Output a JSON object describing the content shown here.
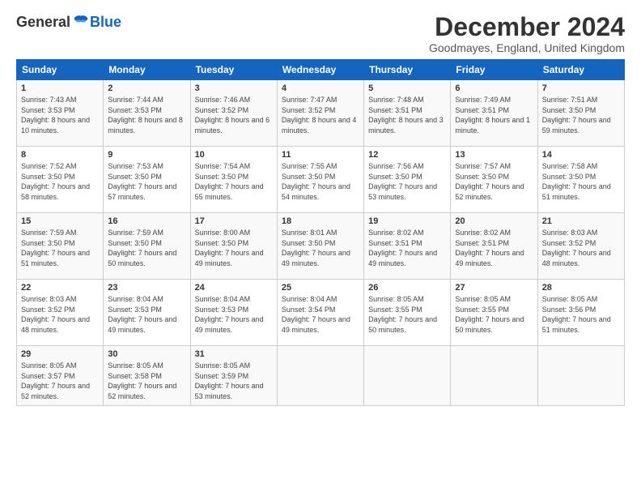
{
  "header": {
    "logo_general": "General",
    "logo_blue": "Blue",
    "title": "December 2024",
    "subtitle": "Goodmayes, England, United Kingdom"
  },
  "columns": [
    "Sunday",
    "Monday",
    "Tuesday",
    "Wednesday",
    "Thursday",
    "Friday",
    "Saturday"
  ],
  "weeks": [
    [
      {
        "day": "1",
        "sunrise": "7:43 AM",
        "sunset": "3:53 PM",
        "daylight": "8 hours and 10 minutes."
      },
      {
        "day": "2",
        "sunrise": "7:44 AM",
        "sunset": "3:53 PM",
        "daylight": "8 hours and 8 minutes."
      },
      {
        "day": "3",
        "sunrise": "7:46 AM",
        "sunset": "3:52 PM",
        "daylight": "8 hours and 6 minutes."
      },
      {
        "day": "4",
        "sunrise": "7:47 AM",
        "sunset": "3:52 PM",
        "daylight": "8 hours and 4 minutes."
      },
      {
        "day": "5",
        "sunrise": "7:48 AM",
        "sunset": "3:51 PM",
        "daylight": "8 hours and 3 minutes."
      },
      {
        "day": "6",
        "sunrise": "7:49 AM",
        "sunset": "3:51 PM",
        "daylight": "8 hours and 1 minute."
      },
      {
        "day": "7",
        "sunrise": "7:51 AM",
        "sunset": "3:50 PM",
        "daylight": "7 hours and 59 minutes."
      }
    ],
    [
      {
        "day": "8",
        "sunrise": "7:52 AM",
        "sunset": "3:50 PM",
        "daylight": "7 hours and 58 minutes."
      },
      {
        "day": "9",
        "sunrise": "7:53 AM",
        "sunset": "3:50 PM",
        "daylight": "7 hours and 57 minutes."
      },
      {
        "day": "10",
        "sunrise": "7:54 AM",
        "sunset": "3:50 PM",
        "daylight": "7 hours and 55 minutes."
      },
      {
        "day": "11",
        "sunrise": "7:55 AM",
        "sunset": "3:50 PM",
        "daylight": "7 hours and 54 minutes."
      },
      {
        "day": "12",
        "sunrise": "7:56 AM",
        "sunset": "3:50 PM",
        "daylight": "7 hours and 53 minutes."
      },
      {
        "day": "13",
        "sunrise": "7:57 AM",
        "sunset": "3:50 PM",
        "daylight": "7 hours and 52 minutes."
      },
      {
        "day": "14",
        "sunrise": "7:58 AM",
        "sunset": "3:50 PM",
        "daylight": "7 hours and 51 minutes."
      }
    ],
    [
      {
        "day": "15",
        "sunrise": "7:59 AM",
        "sunset": "3:50 PM",
        "daylight": "7 hours and 51 minutes."
      },
      {
        "day": "16",
        "sunrise": "7:59 AM",
        "sunset": "3:50 PM",
        "daylight": "7 hours and 50 minutes."
      },
      {
        "day": "17",
        "sunrise": "8:00 AM",
        "sunset": "3:50 PM",
        "daylight": "7 hours and 49 minutes."
      },
      {
        "day": "18",
        "sunrise": "8:01 AM",
        "sunset": "3:50 PM",
        "daylight": "7 hours and 49 minutes."
      },
      {
        "day": "19",
        "sunrise": "8:02 AM",
        "sunset": "3:51 PM",
        "daylight": "7 hours and 49 minutes."
      },
      {
        "day": "20",
        "sunrise": "8:02 AM",
        "sunset": "3:51 PM",
        "daylight": "7 hours and 49 minutes."
      },
      {
        "day": "21",
        "sunrise": "8:03 AM",
        "sunset": "3:52 PM",
        "daylight": "7 hours and 48 minutes."
      }
    ],
    [
      {
        "day": "22",
        "sunrise": "8:03 AM",
        "sunset": "3:52 PM",
        "daylight": "7 hours and 48 minutes."
      },
      {
        "day": "23",
        "sunrise": "8:04 AM",
        "sunset": "3:53 PM",
        "daylight": "7 hours and 49 minutes."
      },
      {
        "day": "24",
        "sunrise": "8:04 AM",
        "sunset": "3:53 PM",
        "daylight": "7 hours and 49 minutes."
      },
      {
        "day": "25",
        "sunrise": "8:04 AM",
        "sunset": "3:54 PM",
        "daylight": "7 hours and 49 minutes."
      },
      {
        "day": "26",
        "sunrise": "8:05 AM",
        "sunset": "3:55 PM",
        "daylight": "7 hours and 50 minutes."
      },
      {
        "day": "27",
        "sunrise": "8:05 AM",
        "sunset": "3:55 PM",
        "daylight": "7 hours and 50 minutes."
      },
      {
        "day": "28",
        "sunrise": "8:05 AM",
        "sunset": "3:56 PM",
        "daylight": "7 hours and 51 minutes."
      }
    ],
    [
      {
        "day": "29",
        "sunrise": "8:05 AM",
        "sunset": "3:57 PM",
        "daylight": "7 hours and 52 minutes."
      },
      {
        "day": "30",
        "sunrise": "8:05 AM",
        "sunset": "3:58 PM",
        "daylight": "7 hours and 52 minutes."
      },
      {
        "day": "31",
        "sunrise": "8:05 AM",
        "sunset": "3:59 PM",
        "daylight": "7 hours and 53 minutes."
      },
      null,
      null,
      null,
      null
    ]
  ]
}
